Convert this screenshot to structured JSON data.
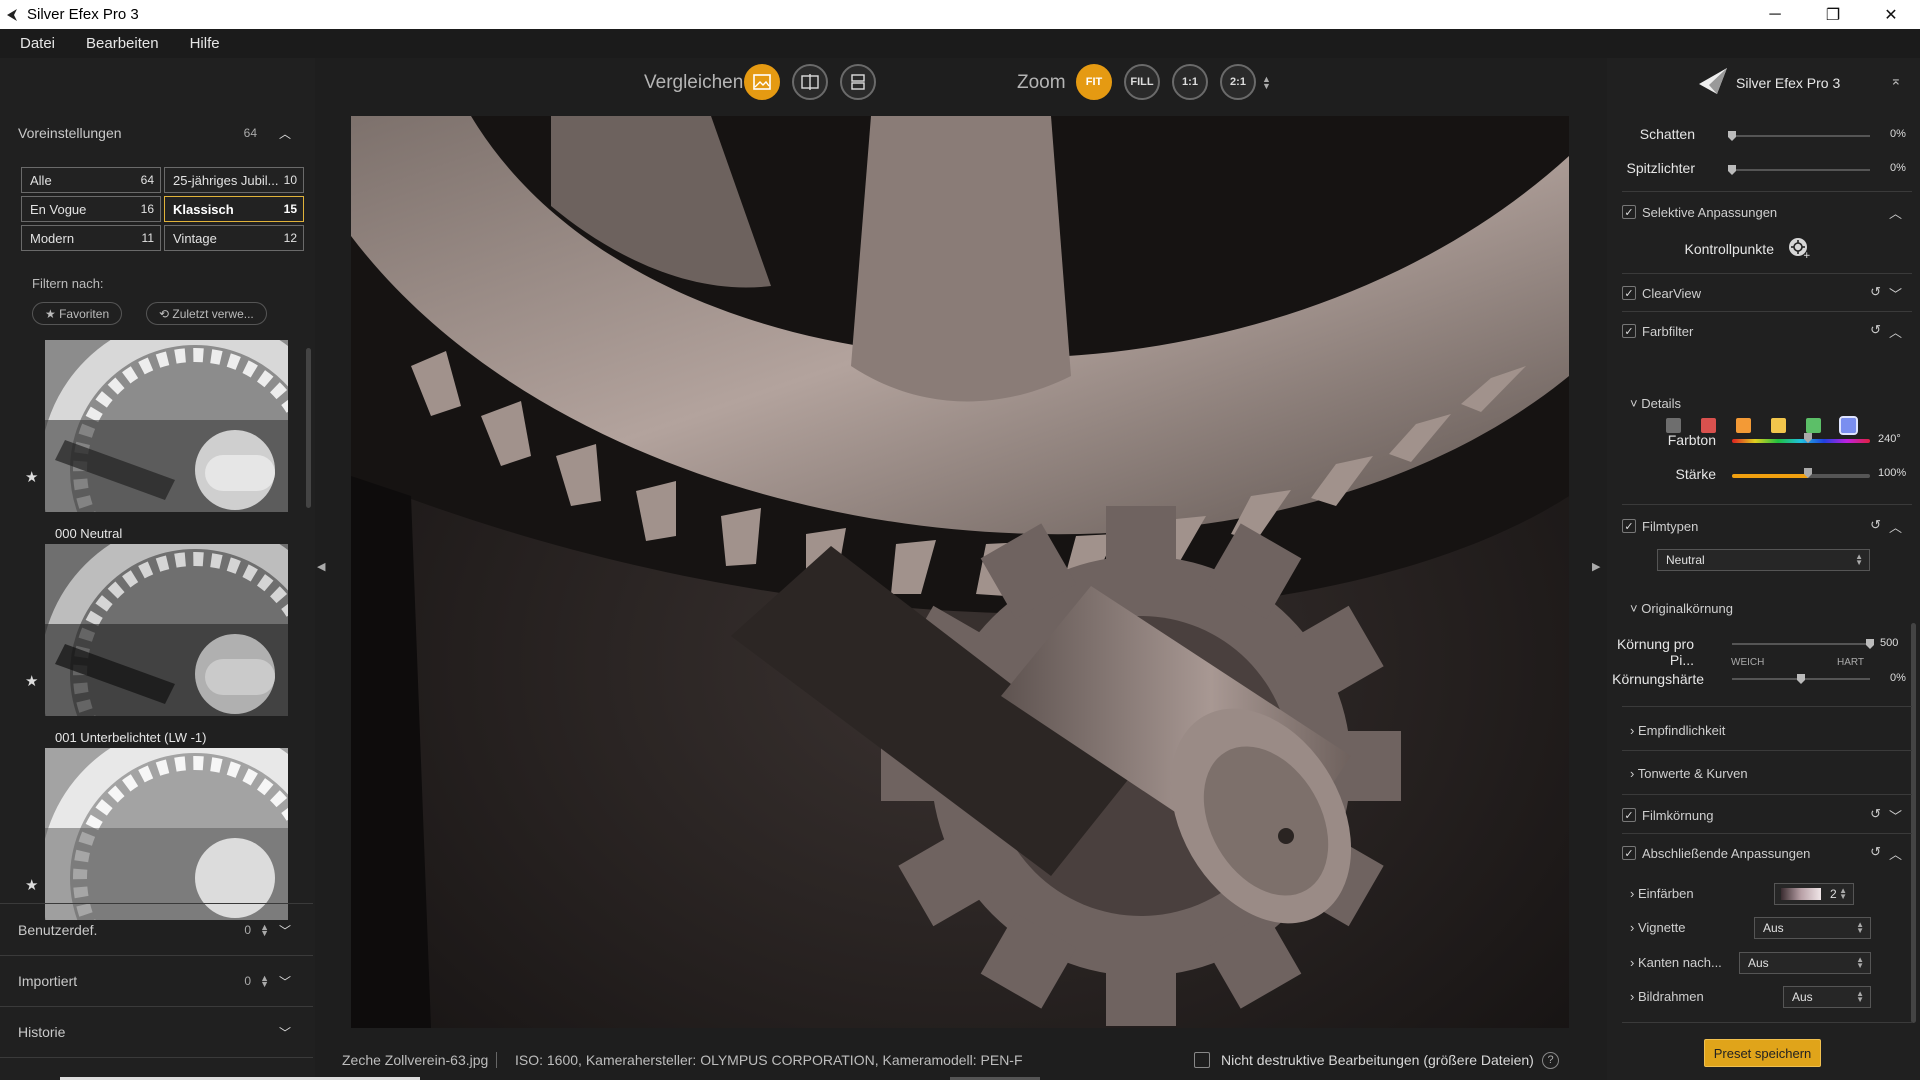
{
  "window": {
    "title": "Silver Efex Pro 3",
    "controls": [
      "─",
      "❐",
      "✕"
    ]
  },
  "menu": [
    "Datei",
    "Bearbeiten",
    "Hilfe"
  ],
  "left": {
    "presets": {
      "title": "Voreinstellungen",
      "count": "64"
    },
    "categories": [
      {
        "label": "Alle",
        "count": "64",
        "active": false
      },
      {
        "label": "25-jähriges Jubil...",
        "count": "10",
        "active": false
      },
      {
        "label": "En Vogue",
        "count": "16",
        "active": false
      },
      {
        "label": "Klassisch",
        "count": "15",
        "active": true
      },
      {
        "label": "Modern",
        "count": "11",
        "active": false
      },
      {
        "label": "Vintage",
        "count": "12",
        "active": false
      }
    ],
    "filter_label": "Filtern nach:",
    "chip_favorites": "★ Favoriten",
    "chip_recent": "⟲ Zuletzt verwe...",
    "thumbs": [
      {
        "label": "000 Neutral"
      },
      {
        "label": "001 Unterbelichtet (LW -1)"
      },
      {
        "label": ""
      }
    ],
    "user_defined": {
      "title": "Benutzerdef.",
      "count": "0"
    },
    "imported": {
      "title": "Importiert",
      "count": "0"
    },
    "history": {
      "title": "Historie"
    }
  },
  "toolbar": {
    "compare_label": "Vergleichen",
    "zoom_label": "Zoom",
    "zoom_fit": "FIT",
    "zoom_fill": "FILL",
    "zoom_1_1": "1:1",
    "zoom_2_1": "2:1"
  },
  "status": {
    "filename": "Zeche Zollverein-63.jpg",
    "meta": "ISO: 1600, Kamerahersteller: OLYMPUS CORPORATION, Kameramodell: PEN-F",
    "nondestructive": "Nicht destruktive Bearbeitungen (größere Dateien)",
    "help": "?"
  },
  "right": {
    "title": "Silver Efex Pro 3",
    "shadows": {
      "label": "Schatten",
      "value": "0%",
      "level": 0
    },
    "highlights": {
      "label": "Spitzlichter",
      "value": "0%",
      "level": 0
    },
    "selective": "Selektive Anpassungen",
    "control_points": "Kontrollpunkte",
    "clearview": "ClearView",
    "colorfilter": "Farbfilter",
    "swatches": [
      "#6e6e6e",
      "#d9514e",
      "#f39a36",
      "#f2c64c",
      "#5cbf68",
      "#7a8ef0"
    ],
    "details": "Details",
    "hue": {
      "label": "Farbton",
      "value": "240°",
      "level": 0.55
    },
    "strength": {
      "label": "Stärke",
      "value": "100%",
      "level": 0.55
    },
    "filmtypes": "Filmtypen",
    "film_value": "Neutral",
    "original_grain": "Originalkörnung",
    "grain_per_px": {
      "label": "Körnung pro Pi...",
      "value": "500",
      "level": 1
    },
    "grain_soft": "WEICH",
    "grain_hard": "HART",
    "grain_hardness": {
      "label": "Körnungshärte",
      "value": "0%",
      "level": 0.5
    },
    "sensitivity": "Empfindlichkeit",
    "tones": "Tonwerte & Kurven",
    "filmgrain": "Filmkörnung",
    "final": "Abschließende Anpassungen",
    "toning": {
      "label": "Einfärben",
      "value": "2"
    },
    "vignette": {
      "label": "Vignette",
      "value": "Aus"
    },
    "edges": {
      "label": "Kanten nach...",
      "value": "Aus"
    },
    "frame": {
      "label": "Bildrahmen",
      "value": "Aus"
    },
    "save": "Preset speichern"
  }
}
